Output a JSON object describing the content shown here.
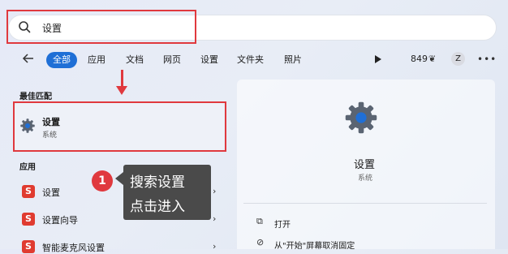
{
  "search": {
    "value": "设置"
  },
  "tabs": [
    {
      "label": "全部",
      "active": true
    },
    {
      "label": "应用"
    },
    {
      "label": "文档"
    },
    {
      "label": "网页"
    },
    {
      "label": "设置"
    },
    {
      "label": "文件夹"
    },
    {
      "label": "照片"
    }
  ],
  "toolbar": {
    "points": "849",
    "avatar_initial": "Z"
  },
  "best_match": {
    "section_label": "最佳匹配",
    "title": "设置",
    "subtitle": "系统"
  },
  "apps": {
    "section_label": "应用",
    "items": [
      {
        "label": "设置",
        "icon_letter": "S"
      },
      {
        "label": "设置向导",
        "icon_letter": "S"
      },
      {
        "label": "智能麦克风设置",
        "icon_letter": "S"
      }
    ]
  },
  "annotation": {
    "step": "1",
    "line1": "搜索设置",
    "line2": "点击进入"
  },
  "detail": {
    "title": "设置",
    "subtitle": "系统",
    "actions": [
      {
        "label": "打开"
      },
      {
        "label": "从\"开始\"屏幕取消固定"
      }
    ]
  },
  "colors": {
    "accent": "#1f6fd6",
    "highlight": "#e0393e",
    "tooltip_bg": "#4a4a4a"
  }
}
